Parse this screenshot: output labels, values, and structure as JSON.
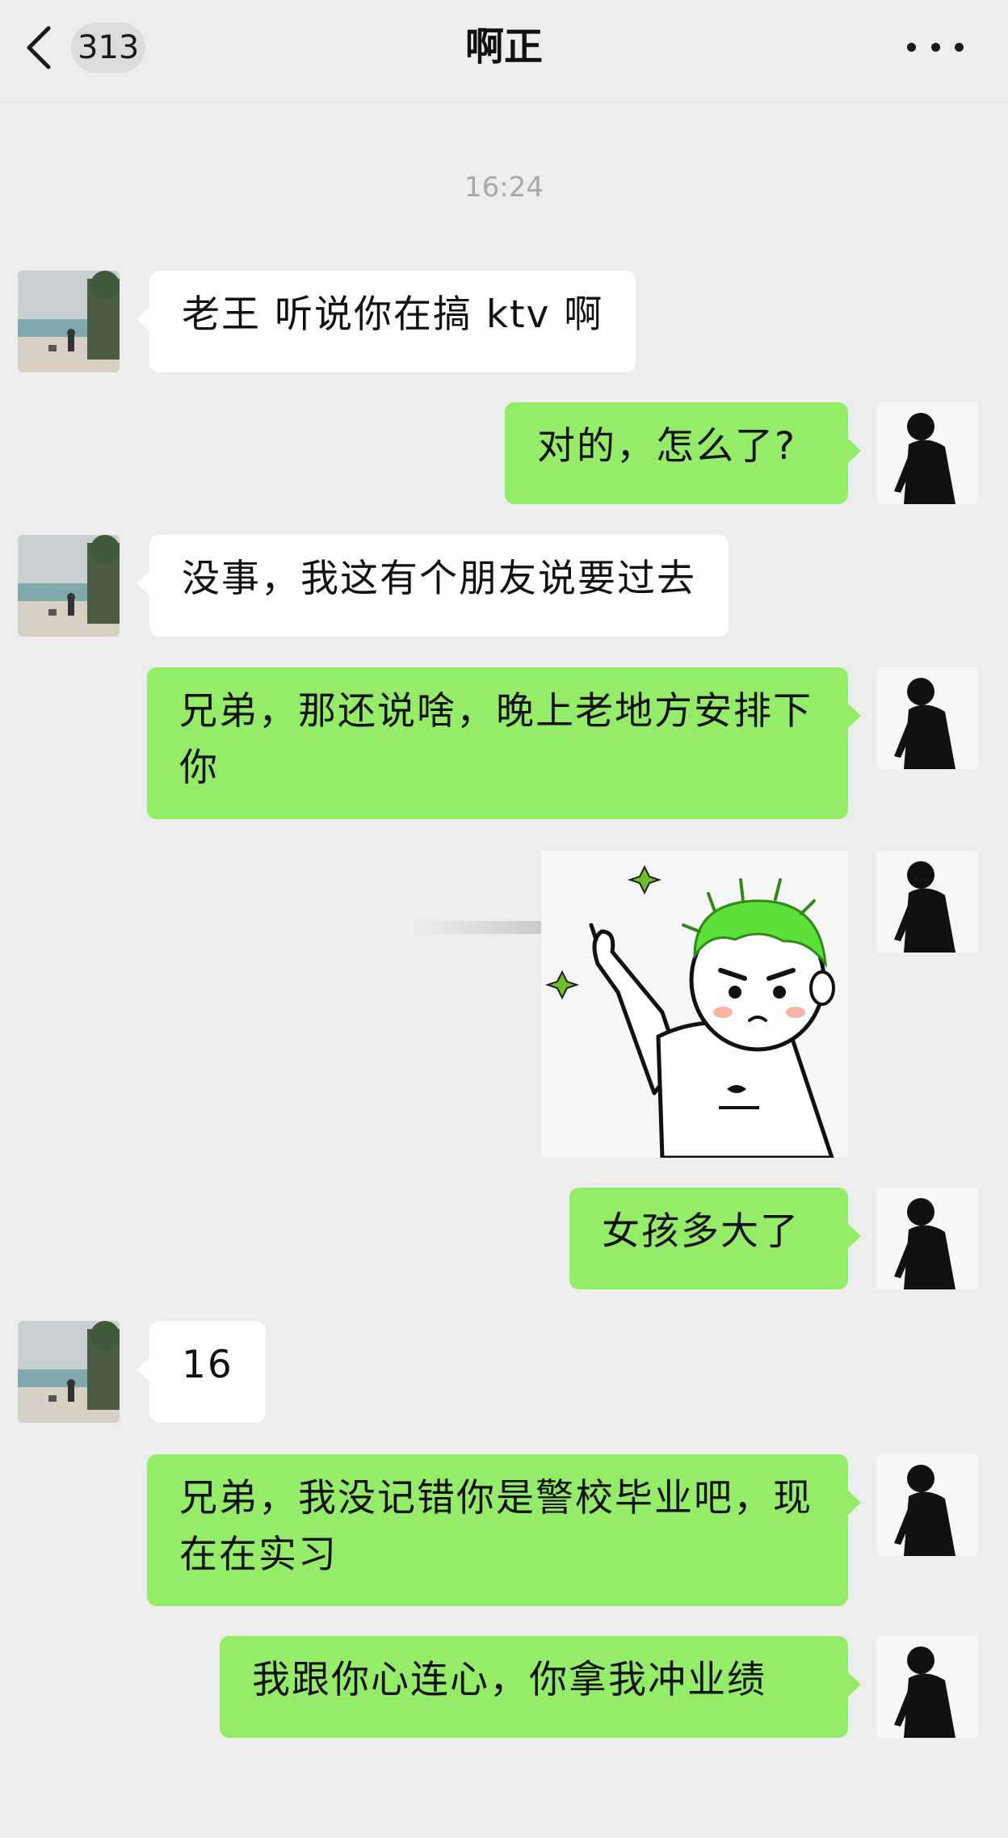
{
  "header": {
    "unread_count": "313",
    "title": "啊正"
  },
  "timestamp": "16:24",
  "messages": [
    {
      "side": "in",
      "text": "老王 听说你在搞 ktv 啊"
    },
    {
      "side": "out",
      "text": "对的，怎么了?"
    },
    {
      "side": "in",
      "text": "没事，我这有个朋友说要过去"
    },
    {
      "side": "out",
      "text": "兄弟，那还说啥，晚上老地方安排下你"
    },
    {
      "side": "out",
      "type": "sticker",
      "sticker": "green-hair-boy-pointing-sticker"
    },
    {
      "side": "out",
      "text": "女孩多大了"
    },
    {
      "side": "in",
      "text": "16"
    },
    {
      "side": "out",
      "text": "兄弟，我没记错你是警校毕业吧，现在在实习"
    },
    {
      "side": "out",
      "text": "我跟你心连心，你拿我冲业绩"
    }
  ],
  "icons": {
    "back": "chevron-left-icon",
    "more": "more-dots-icon"
  },
  "colors": {
    "background": "#ededed",
    "bubble_in": "#ffffff",
    "bubble_out": "#95ec69"
  }
}
